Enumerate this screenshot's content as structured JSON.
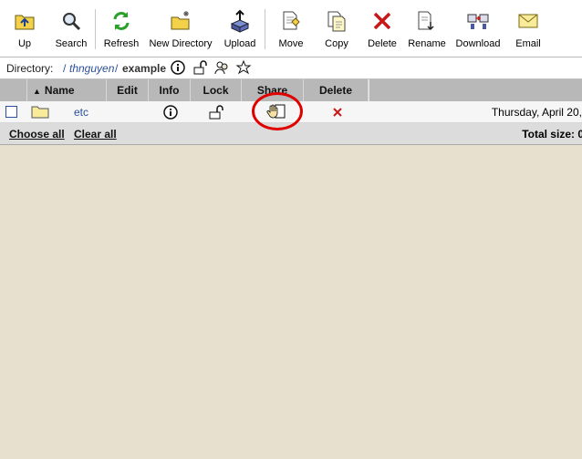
{
  "toolbar": {
    "buttons": [
      {
        "id": "up",
        "label": "Up",
        "icon": "up-folder-icon"
      },
      {
        "id": "search",
        "label": "Search",
        "icon": "search-icon"
      },
      {
        "id": "refresh",
        "label": "Refresh",
        "icon": "refresh-icon"
      },
      {
        "id": "newdir",
        "label": "New Directory",
        "icon": "new-folder-icon"
      },
      {
        "id": "upload",
        "label": "Upload",
        "icon": "upload-icon"
      },
      {
        "id": "move",
        "label": "Move",
        "icon": "move-icon"
      },
      {
        "id": "copy",
        "label": "Copy",
        "icon": "copy-icon"
      },
      {
        "id": "delete",
        "label": "Delete",
        "icon": "delete-x-icon"
      },
      {
        "id": "rename",
        "label": "Rename",
        "icon": "rename-icon"
      },
      {
        "id": "download",
        "label": "Download",
        "icon": "download-icon"
      },
      {
        "id": "email",
        "label": "Email",
        "icon": "email-envelope-icon"
      }
    ]
  },
  "directory": {
    "label": "Directory:",
    "separator": "/",
    "user": "thnguyen",
    "separator2": "/",
    "current": "example"
  },
  "table": {
    "columns": [
      "Name",
      "Edit",
      "Info",
      "Lock",
      "Share",
      "Delete"
    ],
    "sort_indicator": "▲",
    "rows": [
      {
        "name": "etc",
        "type": "folder",
        "date": "Thursday, April 20,"
      }
    ]
  },
  "footer": {
    "choose_all": "Choose all",
    "clear_all": "Clear all",
    "total_size": "Total size: 0"
  },
  "colors": {
    "link": "#2a4f9b",
    "highlight_circle": "#e00000",
    "background": "#e8e0cf"
  }
}
